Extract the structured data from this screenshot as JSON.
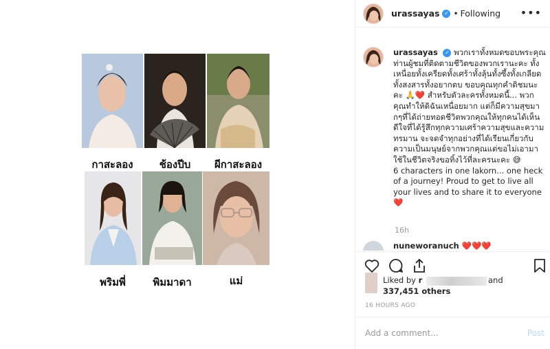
{
  "post": {
    "username": "urassayas",
    "follow_status": "Following",
    "separator": "•",
    "more_label": "•••",
    "verified_glyph": "✓"
  },
  "collage": {
    "captions": [
      "กาสะลอง",
      "ช้องปีบ",
      "ผีกาสะลอง",
      "พริมพี่",
      "พิมมาดา",
      "แม่"
    ]
  },
  "caption": {
    "username": "urassayas",
    "text": "พวกเราทั้งหมดขอบพระคุณท่านผู้ชมที่ติดตามชีวิตของพวกเรานะคะ ทั้งเหนื่อยทั้งเครียดทั้งเศร้าทั้งลุ้นทั้งซึ้งทั้งเกลียดทั้งสงสารทั้งอยากตบ ขอบคุณทุกคำติชมนะคะ 🙏❤️ สำหรับตัวละครทั้งหมดนี้... พวกคุณทำให้ดิฉันเหนื่อยมาก แต่ก็มีความสุขมากๆที่ได้ถ่ายทอดชีวิตพวกคุณให้ทุกคนได้เห็น ดีใจที่ได้รู้สึกทุกความเศร้าความสุขและความทรมาน จะจดจำทุกอย่างที่ได้เรียนเกี่ยวกับความเป็นมนุษย์จากพวกคุณแต่ขอไม่เอามาใช้ในชีวิตจริงขอทิ้งไว้ที่ละครนะคะ 😅",
    "text_en": "6 characters in one lakorn... one heck of a journey! Proud to get to live all your lives and to share it to everyone",
    "heart": "❤️",
    "time": "16h"
  },
  "second_comment": {
    "username": "nuneworanuch",
    "text": "❤️❤️❤️"
  },
  "likes": {
    "liked_by": "Liked by",
    "first_liker_initial": "r",
    "and": "and",
    "others": "337,451 others"
  },
  "timestamp": "16 HOURS AGO",
  "comment_box": {
    "placeholder": "Add a comment...",
    "post_label": "Post"
  },
  "icons": {
    "like": "heart-icon",
    "comment": "comment-icon",
    "share": "share-icon",
    "save": "bookmark-icon"
  }
}
